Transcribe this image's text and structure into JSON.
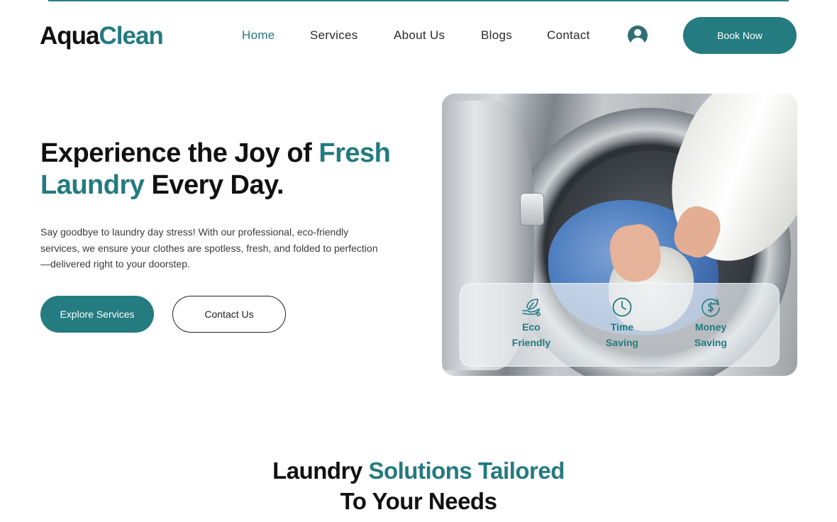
{
  "brand": {
    "logo_part1": "Aqua",
    "logo_part2": "Clean",
    "accent_color": "#237a80"
  },
  "nav": {
    "items": [
      {
        "label": "Home",
        "active": true
      },
      {
        "label": "Services",
        "active": false
      },
      {
        "label": "About Us",
        "active": false
      },
      {
        "label": "Blogs",
        "active": false
      },
      {
        "label": "Contact",
        "active": false
      }
    ],
    "account_icon": "account-icon",
    "book_label": "Book Now"
  },
  "hero": {
    "title_part1": "Experience the Joy of ",
    "title_accent": "Fresh Laundry",
    "title_part2": " Every Day.",
    "description": "Say goodbye to laundry day stress! With our professional, eco-friendly services, we ensure your clothes are spotless, fresh, and folded to perfection—delivered right to your doorstep.",
    "primary_button": "Explore Services",
    "secondary_button": "Contact Us"
  },
  "features": [
    {
      "icon": "leaf-hand-icon",
      "line1": "Eco",
      "line2": "Friendly"
    },
    {
      "icon": "clock-icon",
      "line1": "Time",
      "line2": "Saving"
    },
    {
      "icon": "dollar-coin-icon",
      "line1": "Money",
      "line2": "Saving"
    }
  ],
  "section2": {
    "title_part1": "Laundry ",
    "title_accent": "Solutions Tailored",
    "title_part2": "To Your Needs"
  }
}
